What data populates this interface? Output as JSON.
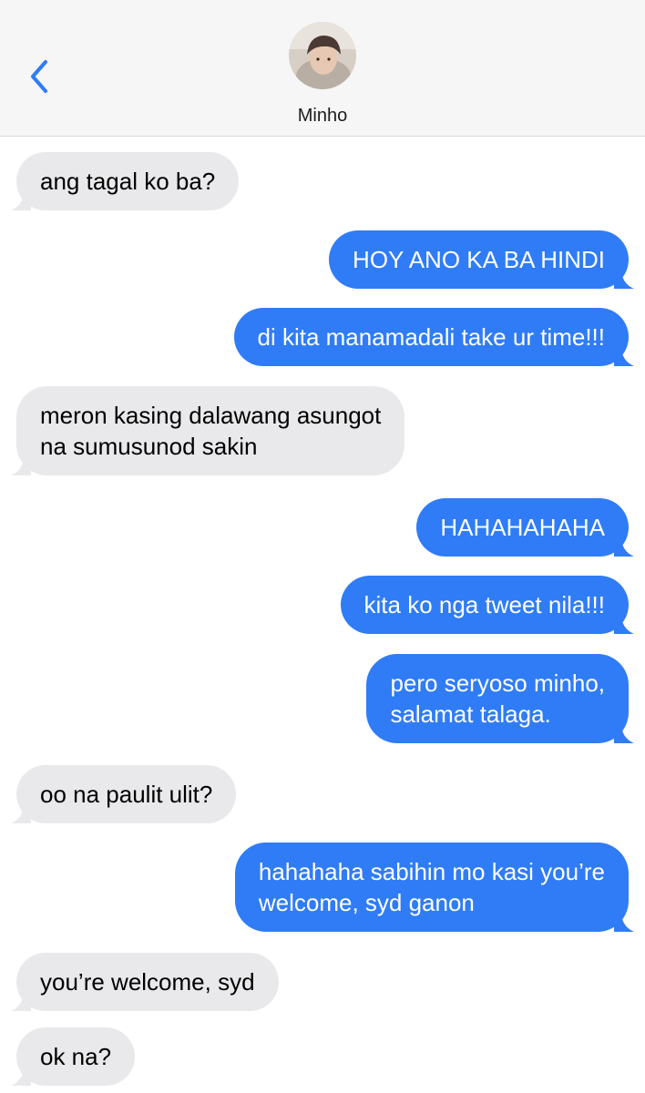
{
  "header": {
    "back_icon": "chevron-left-icon",
    "contact_name": "Minho",
    "avatar_icon": "contact-avatar"
  },
  "colors": {
    "incoming_bubble": "#e9e9eb",
    "outgoing_bubble": "#2f7cf6",
    "accent": "#2f7cf6"
  },
  "messages": [
    {
      "direction": "in",
      "lines": [
        "ang tagal ko ba?"
      ]
    },
    {
      "direction": "out",
      "lines": [
        "HOY ANO KA BA HINDI"
      ]
    },
    {
      "direction": "out",
      "lines": [
        "di kita manamadali take ur time!!!"
      ]
    },
    {
      "direction": "in",
      "lines": [
        "meron kasing dalawang asungot",
        "na sumusunod sakin"
      ]
    },
    {
      "direction": "out",
      "lines": [
        "HAHAHAHAHA"
      ]
    },
    {
      "direction": "out",
      "lines": [
        "kita ko nga tweet nila!!!"
      ]
    },
    {
      "direction": "out",
      "lines": [
        "pero seryoso minho,",
        "salamat talaga."
      ]
    },
    {
      "direction": "in",
      "lines": [
        "oo na paulit ulit?"
      ]
    },
    {
      "direction": "out",
      "lines": [
        "hahahaha sabihin mo kasi you’re",
        "welcome, syd ganon"
      ]
    },
    {
      "direction": "in",
      "lines": [
        "you’re welcome, syd"
      ]
    },
    {
      "direction": "in",
      "lines": [
        "ok na?"
      ]
    }
  ]
}
